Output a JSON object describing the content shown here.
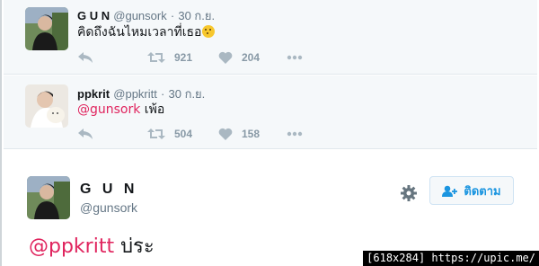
{
  "tweets": [
    {
      "name": "G U N",
      "handle": "@gunsork",
      "date": "30 ก.ย.",
      "text": "คิดถึงฉันไหมเวลาที่เธอ",
      "emoji": "thinking-face",
      "retweets": "921",
      "likes": "204"
    },
    {
      "name": "ppkrit",
      "handle": "@ppkritt",
      "date": "30 ก.ย.",
      "mention": "@gunsork",
      "text": " เพ้อ",
      "retweets": "504",
      "likes": "158"
    }
  ],
  "main_tweet": {
    "name": "G U N",
    "handle": "@gunsork",
    "follow_label": "ติดตาม",
    "mention": "@ppkritt",
    "text": " บ่ระ"
  },
  "watermark": "[618x284] https://upic.me/",
  "colors": {
    "mention": "#e0245e",
    "link_blue": "#1b95e0",
    "action_gray": "#8899a6"
  }
}
